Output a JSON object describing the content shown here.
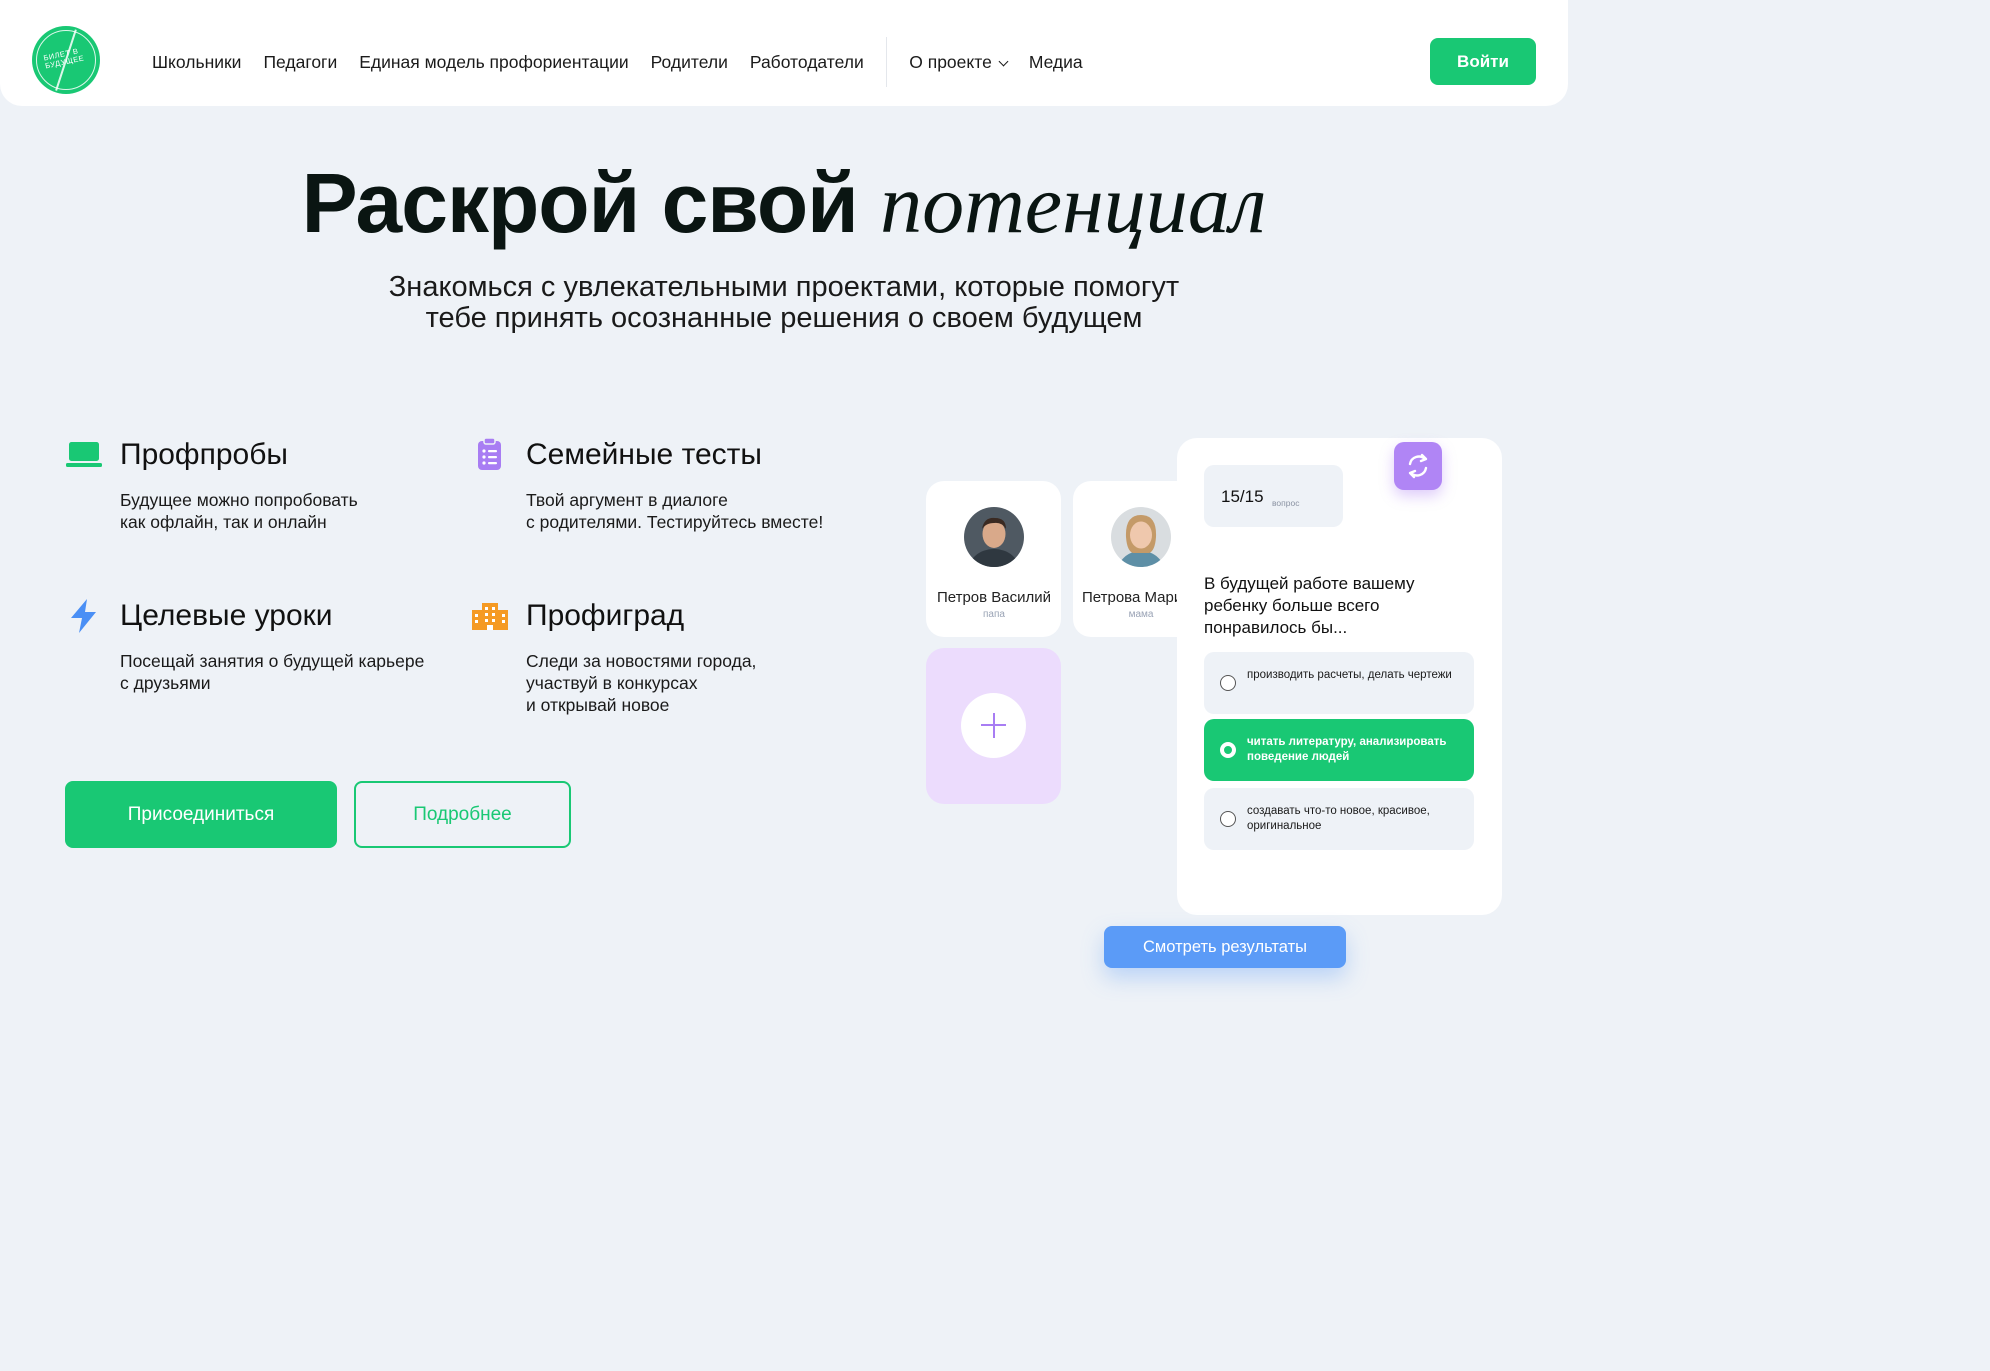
{
  "header": {
    "logo_text": "Билет в будущее",
    "nav": [
      "Школьники",
      "Педагоги",
      "Единая модель профориентации",
      "Родители",
      "Работодатели"
    ],
    "nav_secondary": [
      "О проекте",
      "Медиа"
    ],
    "login_label": "Войти"
  },
  "hero": {
    "title_bold": "Раскрой свой",
    "title_italic": "потенциал",
    "subtitle_line1": "Знакомься с увлекательными проектами, которые помогут",
    "subtitle_line2": "тебе принять осознанные решения о своем будущем"
  },
  "features": [
    {
      "title": "Профпробы",
      "desc1": "Будущее можно попробовать",
      "desc2": "как офлайн, так и онлайн",
      "desc3": "",
      "icon": "laptop-icon",
      "color": "#19c874"
    },
    {
      "title": "Семейные тесты",
      "desc1": "Твой аргумент в диалоге",
      "desc2": "с родителями. Тестируйтесь вместе!",
      "desc3": "",
      "icon": "clipboard-icon",
      "color": "#a87df3"
    },
    {
      "title": "Целевые уроки",
      "desc1": "Посещай занятия о будущей карьере",
      "desc2": "с друзьями",
      "desc3": "",
      "icon": "lightning-icon",
      "color": "#4a8ff5"
    },
    {
      "title": "Профиград",
      "desc1": "Следи за новостями города,",
      "desc2": "участвуй в конкурсах",
      "desc3": "и открывай новое",
      "icon": "building-icon",
      "color": "#f59a23"
    }
  ],
  "actions": {
    "join_label": "Присоединиться",
    "more_label": "Подробнее"
  },
  "family": {
    "members": [
      {
        "name": "Петров Василий",
        "role": "папа"
      },
      {
        "name": "Петрова Мария",
        "role": "мама"
      }
    ]
  },
  "quiz": {
    "counter": "15/15",
    "counter_label": "вопрос",
    "question": "В будущей работе вашему ребенку больше всего понравилось бы...",
    "options": [
      {
        "text": "производить расчеты, делать чертежи",
        "selected": false
      },
      {
        "text": "читать литературу, анализировать поведение людей",
        "selected": true
      },
      {
        "text": "создавать что-то новое, красивое, оригинальное",
        "selected": false
      }
    ],
    "results_label": "Смотреть результаты"
  },
  "colors": {
    "accent": "#19c874",
    "purple": "#a87df3",
    "blue": "#5b9bf7",
    "background": "#eef2f7"
  }
}
